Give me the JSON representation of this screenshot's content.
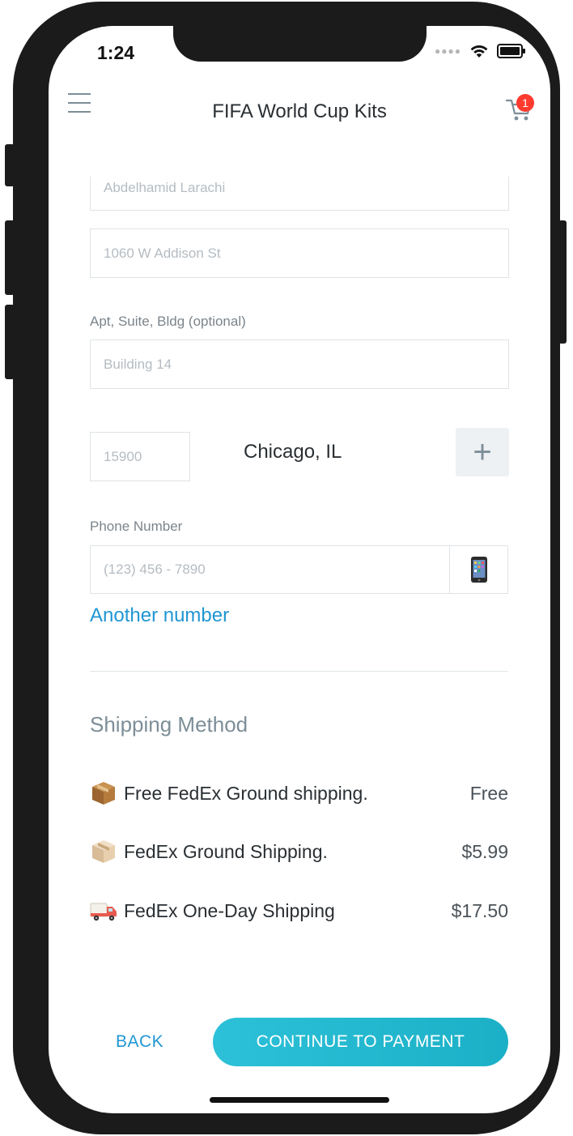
{
  "status_bar": {
    "time": "1:24"
  },
  "nav": {
    "title": "FIFA World Cup Kits",
    "cart_count": "1"
  },
  "form": {
    "name_placeholder": "Abdelhamid Larachi",
    "address_placeholder": "1060 W Addison St",
    "apt_label": "Apt, Suite, Bldg (optional)",
    "apt_placeholder": "Building 14",
    "zip_placeholder": "15900",
    "city_state": "Chicago, IL",
    "phone_label": "Phone Number",
    "phone_placeholder": "(123) 456 - 7890",
    "another_number": "Another number"
  },
  "shipping": {
    "heading": "Shipping Method",
    "options": [
      {
        "icon": "package-icon",
        "name": "Free FedEx Ground shipping.",
        "price": "Free"
      },
      {
        "icon": "box-icon",
        "name": "FedEx Ground Shipping.",
        "price": "$5.99"
      },
      {
        "icon": "delivery-truck-icon",
        "name": "FedEx One-Day Shipping",
        "price": "$17.50"
      }
    ]
  },
  "actions": {
    "back": "BACK",
    "continue": "CONTINUE TO PAYMENT"
  },
  "colors": {
    "accent_link": "#2196d3",
    "button_gradient_start": "#2cc1d8",
    "button_gradient_end": "#1cb0c7",
    "badge": "#ff3b30"
  }
}
